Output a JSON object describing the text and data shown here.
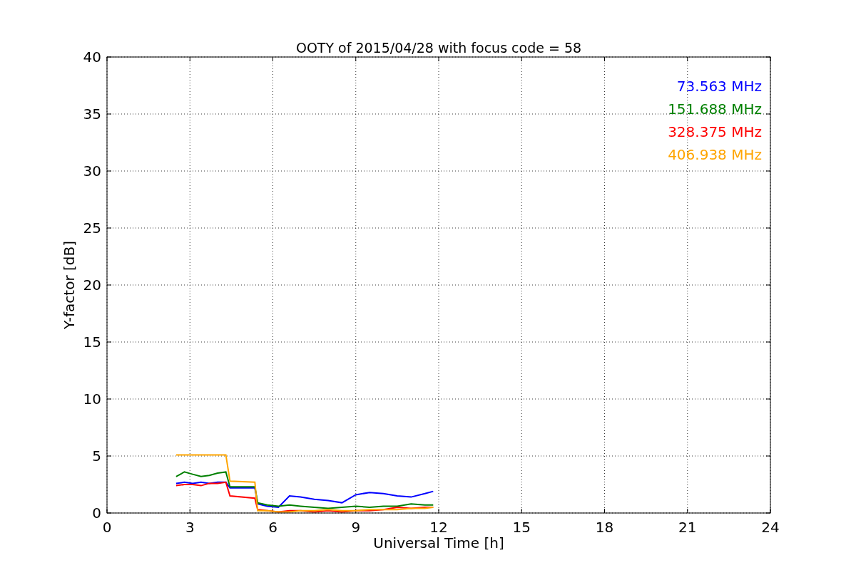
{
  "chart_data": {
    "type": "line",
    "title": "OOTY of 2015/04/28 with focus code = 58",
    "xlabel": "Universal Time [h]",
    "ylabel": "Y-factor [dB]",
    "x": [
      2.5,
      2.8,
      3.1,
      3.4,
      3.7,
      4.0,
      4.3,
      4.45,
      5.35,
      5.45,
      5.8,
      6.2,
      6.6,
      7,
      7.5,
      8,
      8.5,
      9,
      9.5,
      10,
      10.5,
      11,
      11.5,
      11.8
    ],
    "series": [
      {
        "name": "73.563 MHz",
        "color": "#0000ff",
        "values": [
          2.6,
          2.7,
          2.6,
          2.7,
          2.6,
          2.7,
          2.7,
          2.2,
          2.2,
          0.8,
          0.6,
          0.5,
          1.5,
          1.4,
          1.2,
          1.1,
          0.9,
          1.6,
          1.8,
          1.7,
          1.5,
          1.4,
          1.7,
          1.9
        ]
      },
      {
        "name": "151.688 MHz",
        "color": "#008000",
        "values": [
          3.2,
          3.6,
          3.4,
          3.2,
          3.3,
          3.5,
          3.6,
          2.3,
          2.3,
          0.9,
          0.7,
          0.6,
          0.7,
          0.6,
          0.5,
          0.4,
          0.5,
          0.6,
          0.5,
          0.6,
          0.6,
          0.8,
          0.7,
          0.7
        ]
      },
      {
        "name": "328.375 MHz",
        "color": "#ff0000",
        "values": [
          2.4,
          2.5,
          2.5,
          2.4,
          2.6,
          2.6,
          2.7,
          1.5,
          1.3,
          0.3,
          0.2,
          0.1,
          0.2,
          0.2,
          0.1,
          0.2,
          0.1,
          0.2,
          0.2,
          0.3,
          0.5,
          0.4,
          0.5,
          0.5
        ]
      },
      {
        "name": "406.938 MHz",
        "color": "#ffa500",
        "values": [
          5.1,
          5.1,
          5.1,
          5.1,
          5.1,
          5.1,
          5.1,
          2.8,
          2.7,
          0.2,
          0.2,
          0.1,
          0.1,
          0.2,
          0.2,
          0.3,
          0.2,
          0.2,
          0.3,
          0.3,
          0.3,
          0.4,
          0.4,
          0.5
        ]
      }
    ],
    "xlim": [
      0,
      24
    ],
    "ylim": [
      0,
      40
    ],
    "xticks": [
      0,
      3,
      6,
      9,
      12,
      15,
      18,
      21,
      24
    ],
    "yticks": [
      0,
      5,
      10,
      15,
      20,
      25,
      30,
      35,
      40
    ],
    "grid": true
  }
}
